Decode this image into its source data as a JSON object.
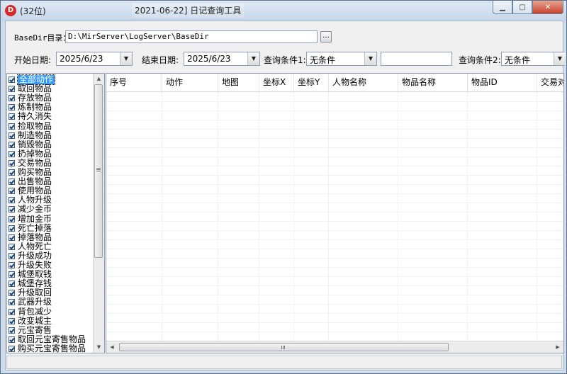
{
  "window": {
    "title_left": "(32位)",
    "title_center": "2021-06-22] 日记查询工具",
    "app_icon": "D"
  },
  "icons": {
    "minimize": "minimize-icon",
    "maximize": "maximize-icon",
    "close": "close-icon"
  },
  "basedir": {
    "label": "BaseDir目录：",
    "value": "D:\\MirServer\\LogServer\\BaseDir",
    "browse_label": "..."
  },
  "filters": {
    "start_label": "开始日期:",
    "start_value": "2025/6/23",
    "end_label": "结束日期:",
    "end_value": "2025/6/23",
    "cond1_label": "查询条件1:",
    "cond1_value": "无条件",
    "cond1_text": "",
    "cond2_label": "查询条件2:",
    "cond2_value": "无条件"
  },
  "checklist": {
    "selected_index": 0,
    "items": [
      "全部动作",
      "取回物品",
      "存放物品",
      "炼制物品",
      "持久消失",
      "捡取物品",
      "制造物品",
      "销毁物品",
      "扔掉物品",
      "交易物品",
      "购买物品",
      "出售物品",
      "使用物品",
      "人物升级",
      "减少金币",
      "增加金币",
      "死亡掉落",
      "掉落物品",
      "人物死亡",
      "升级成功",
      "升级失败",
      "城堡取钱",
      "城堡存钱",
      "升级取回",
      "武器升级",
      "背包减少",
      "改变城主",
      "元宝寄售",
      "取回元宝寄售物品",
      "购买元宝寄售物品"
    ]
  },
  "grid": {
    "columns": [
      "序号",
      "动作",
      "地图",
      "坐标X",
      "坐标Y",
      "人物名称",
      "物品名称",
      "物品ID",
      "交易对象"
    ]
  }
}
